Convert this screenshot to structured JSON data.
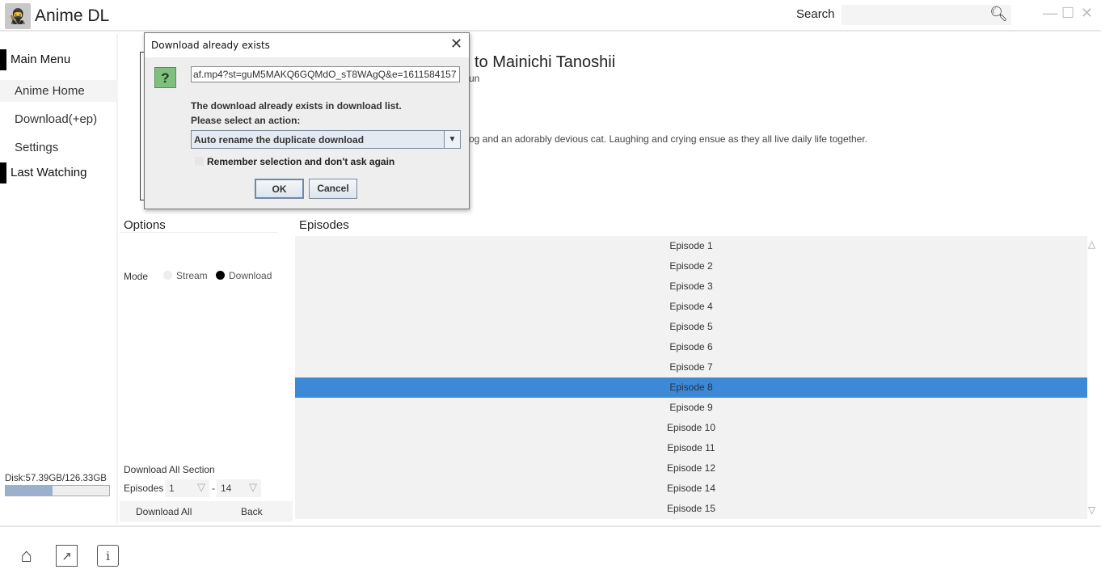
{
  "app": {
    "title": "Anime DL",
    "search_label": "Search",
    "search_placeholder": ""
  },
  "sidebar": {
    "main_menu": "Main Menu",
    "items": [
      {
        "label": "Anime Home"
      },
      {
        "label": "Download(+ep)"
      },
      {
        "label": "Settings"
      }
    ],
    "last_watching": "Last Watching",
    "disk": {
      "label": "Disk:57.39GB/126.33GB",
      "used_fraction": 0.454
    }
  },
  "anime": {
    "title_visible": "to Mainichi Tanoshii",
    "subtitle_visible": "un",
    "description_visible": "og and an adorably devious cat. Laughing and crying ensue as they all live daily life together."
  },
  "options": {
    "title": "Options",
    "mode_label": "Mode",
    "modes": [
      {
        "label": "Stream",
        "selected": false
      },
      {
        "label": "Download",
        "selected": true
      }
    ],
    "download_all_section": "Download All Section",
    "episodes_label": "Episodes",
    "from": "1",
    "dash": "-",
    "to": "14",
    "download_all": "Download All",
    "back": "Back"
  },
  "episodes": {
    "title": "Episodes",
    "items": [
      "Episode 1",
      "Episode 2",
      "Episode 3",
      "Episode 4",
      "Episode 5",
      "Episode 6",
      "Episode 7",
      "Episode 8",
      "Episode 9",
      "Episode 10",
      "Episode 11",
      "Episode 12",
      "Episode 14",
      "Episode 15"
    ],
    "selected": "Episode 8",
    "selected_color": "#3d89d7"
  },
  "dialog": {
    "title": "Download already exists",
    "url": "af.mp4?st=guM5MAKQ6GQMdO_sT8WAgQ&e=1611584157",
    "message": "The download already exists in download list.",
    "prompt": "Please select an action:",
    "action": "Auto rename the duplicate download",
    "remember": "Remember selection and don't ask again",
    "remember_checked": false,
    "ok": "OK",
    "cancel": "Cancel"
  },
  "footer": {
    "icons": [
      "home-icon",
      "open-window-icon",
      "info-icon"
    ]
  }
}
